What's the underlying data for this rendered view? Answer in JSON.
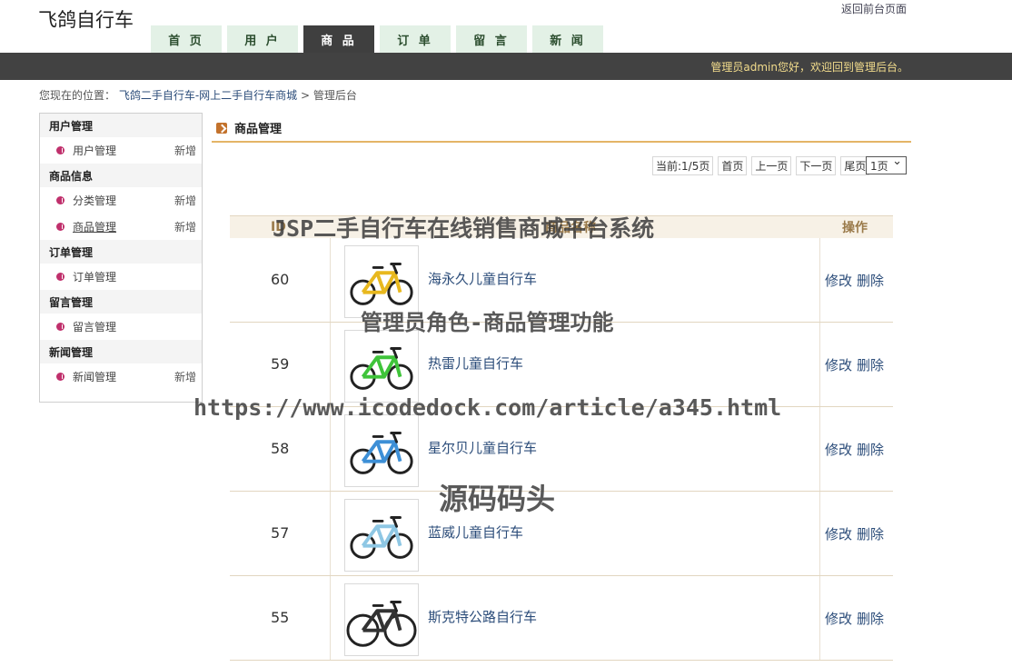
{
  "site": {
    "title": "飞鸽自行车",
    "front_link": "返回前台页面"
  },
  "nav": {
    "tabs": [
      {
        "label": "首 页",
        "active": false
      },
      {
        "label": "用 户",
        "active": false
      },
      {
        "label": "商 品",
        "active": true
      },
      {
        "label": "订 单",
        "active": false
      },
      {
        "label": "留 言",
        "active": false
      },
      {
        "label": "新 闻",
        "active": false
      }
    ]
  },
  "topbar": {
    "welcome": "管理员admin您好，欢迎回到管理后台。"
  },
  "breadcrumb": {
    "prefix": "您现在的位置：",
    "link": "飞鸽二手自行车-网上二手自行车商城",
    "sep": ">",
    "current": "管理后台"
  },
  "sidebar": {
    "groups": [
      {
        "title": "用户管理",
        "items": [
          {
            "label": "用户管理",
            "add": "新增"
          }
        ]
      },
      {
        "title": "商品信息",
        "items": [
          {
            "label": "分类管理",
            "add": "新增"
          },
          {
            "label": "商品管理",
            "add": "新增"
          }
        ]
      },
      {
        "title": "订单管理",
        "items": [
          {
            "label": "订单管理",
            "add": ""
          }
        ]
      },
      {
        "title": "留言管理",
        "items": [
          {
            "label": "留言管理",
            "add": ""
          }
        ]
      },
      {
        "title": "新闻管理",
        "items": [
          {
            "label": "新闻管理",
            "add": "新增"
          }
        ]
      }
    ]
  },
  "panel": {
    "title": "商品管理"
  },
  "pager": {
    "status": "当前:1/5页",
    "first": "首页",
    "prev": "上一页",
    "next": "下一页",
    "last": "尾页",
    "select": "1页"
  },
  "table": {
    "headers": {
      "id": "ID",
      "name": "商品名称",
      "op": "操作"
    },
    "rows": [
      {
        "id": "60",
        "name": "海永久儿童自行车",
        "edit": "修改",
        "delete": "删除"
      },
      {
        "id": "59",
        "name": "热雷儿童自行车",
        "edit": "修改",
        "delete": "删除"
      },
      {
        "id": "58",
        "name": "星尔贝儿童自行车",
        "edit": "修改",
        "delete": "删除"
      },
      {
        "id": "57",
        "name": "蓝威儿童自行车",
        "edit": "修改",
        "delete": "删除"
      },
      {
        "id": "55",
        "name": "斯克特公路自行车",
        "edit": "修改",
        "delete": "删除"
      }
    ]
  },
  "bike_colors": [
    "#e8b81e",
    "#3fc43a",
    "#3d8fd6",
    "#8ec7e4",
    "#333333"
  ],
  "watermark": {
    "line1": "JSP二手自行车在线销售商城平台系统",
    "line2": "管理员角色-商品管理功能",
    "line3": "https://www.icodedock.com/article/a345.html",
    "line4": "源码码头"
  }
}
